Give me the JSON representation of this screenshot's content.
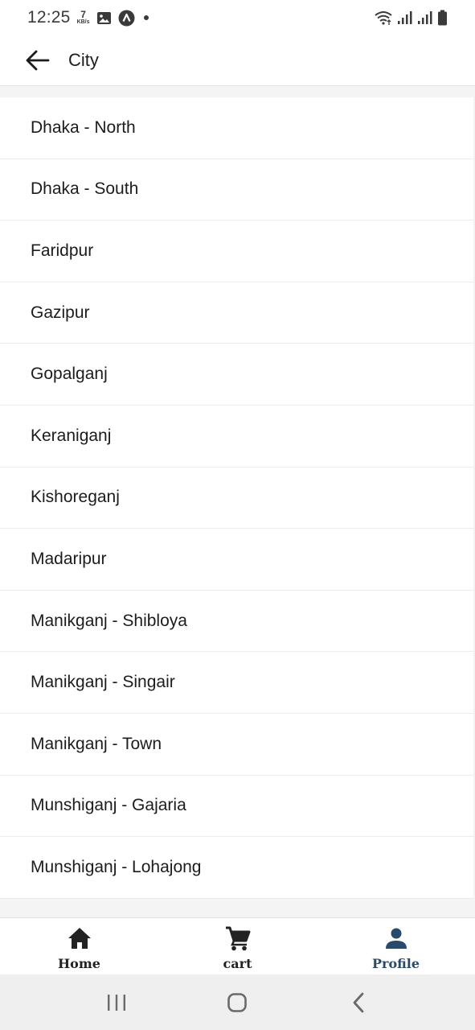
{
  "status_bar": {
    "time": "12:25",
    "net_speed_value": "7",
    "net_speed_unit": "KB/s",
    "icons": [
      "image-icon",
      "app-a-icon",
      "dot-icon",
      "wifi-icon",
      "signal-icon",
      "signal-icon",
      "battery-icon"
    ]
  },
  "app_bar": {
    "back_icon": "arrow-left-icon",
    "title": "City"
  },
  "cities": [
    "Dhaka - North",
    "Dhaka - South",
    "Faridpur",
    "Gazipur",
    "Gopalganj",
    "Keraniganj",
    "Kishoreganj",
    "Madaripur",
    "Manikganj - Shibloya",
    "Manikganj - Singair",
    "Manikganj - Town",
    "Munshiganj - Gajaria",
    "Munshiganj - Lohajong"
  ],
  "bottom_nav": {
    "items": [
      {
        "label": "Home",
        "icon": "home-icon",
        "active": false
      },
      {
        "label": "cart",
        "icon": "cart-icon",
        "active": false
      },
      {
        "label": "Profile",
        "icon": "person-icon",
        "active": true
      }
    ]
  },
  "colors": {
    "active_nav": "#2a4a6b",
    "text": "#1c1c1c",
    "divider": "#ececec"
  }
}
